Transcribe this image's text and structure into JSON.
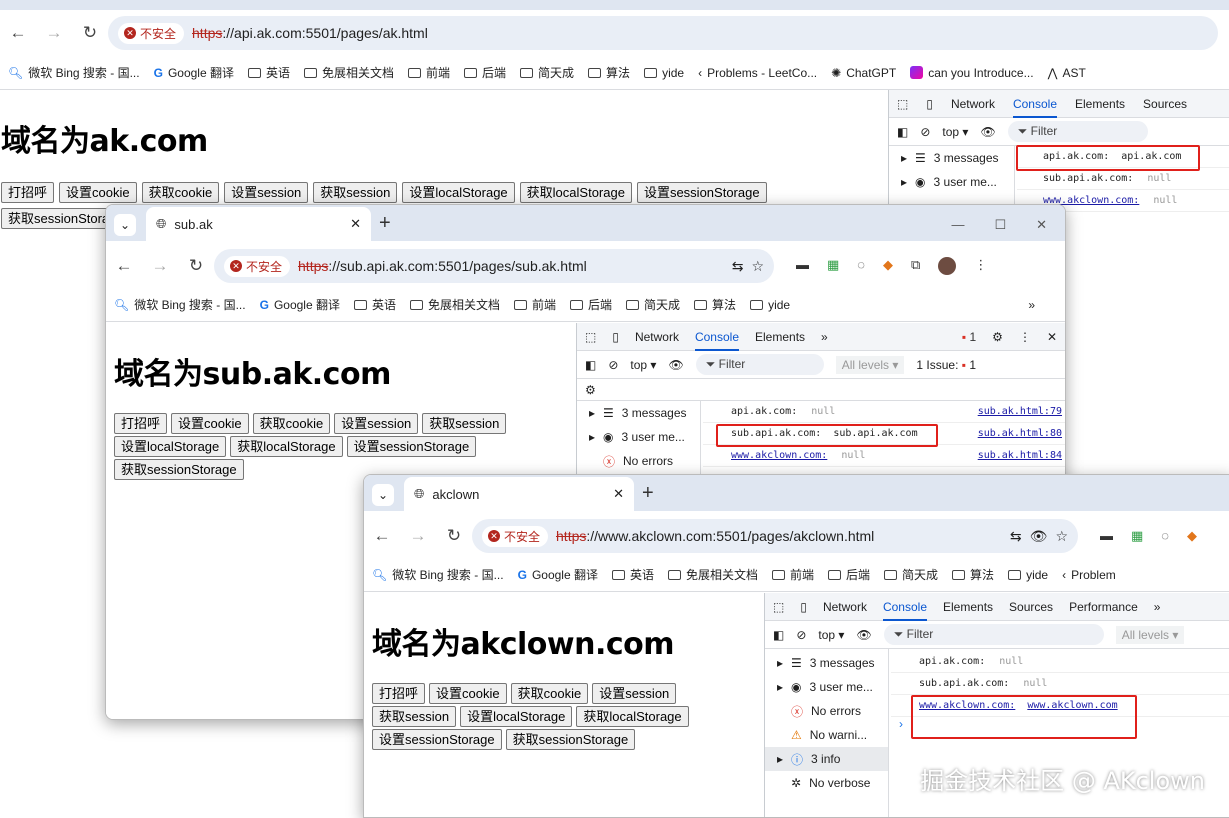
{
  "w1": {
    "url_scheme": "https",
    "url_rest": "://api.ak.com:5501/pages/ak.html",
    "insecure": "不安全",
    "bookmarks": [
      "微软 Bing 搜索 - 国...",
      "Google 翻译",
      "英语",
      "免展相关文档",
      "前端",
      "后端",
      "简天成",
      "算法",
      "yide",
      "Problems - LeetCo...",
      "ChatGPT",
      "can you Introduce...",
      "AST"
    ],
    "title": "域名为ak.com",
    "buttons": [
      "打招呼",
      "设置cookie",
      "获取cookie",
      "设置session",
      "获取session",
      "设置localStorage",
      "获取localStorage",
      "设置sessionStorage",
      "获取sessionStorage"
    ],
    "dt_tabs": [
      "Network",
      "Console",
      "Elements",
      "Sources"
    ],
    "top": "top",
    "filter": "Filter",
    "side": [
      "3 messages",
      "3 user me..."
    ],
    "logs": [
      {
        "k": "api.ak.com:",
        "v": "api.ak.com"
      },
      {
        "k": "sub.api.ak.com:",
        "v": "null"
      },
      {
        "k": "www.akclown.com:",
        "v": "null"
      }
    ]
  },
  "w2": {
    "tab_title": "sub.ak",
    "url_scheme": "https",
    "url_rest": "://sub.api.ak.com:5501/pages/sub.ak.html",
    "insecure": "不安全",
    "bookmarks": [
      "微软 Bing 搜索 - 国...",
      "Google 翻译",
      "英语",
      "免展相关文档",
      "前端",
      "后端",
      "简天成",
      "算法",
      "yide"
    ],
    "title": "域名为sub.ak.com",
    "buttons": [
      "打招呼",
      "设置cookie",
      "获取cookie",
      "设置session",
      "获取session",
      "设置localStorage",
      "获取localStorage",
      "设置sessionStorage",
      "获取sessionStorage"
    ],
    "dt_tabs": [
      "Network",
      "Console",
      "Elements"
    ],
    "errors": "1",
    "top": "top",
    "filter": "Filter",
    "levels": "All levels",
    "issue_label": "1 Issue:",
    "issue_count": "1",
    "side": [
      "3 messages",
      "3 user me...",
      "No errors"
    ],
    "logs": [
      {
        "k": "api.ak.com:",
        "v": "null",
        "src": "sub.ak.html:79"
      },
      {
        "k": "sub.api.ak.com:",
        "v": "sub.api.ak.com",
        "src": "sub.ak.html:80"
      },
      {
        "k": "www.akclown.com:",
        "v": "null",
        "src": "sub.ak.html:84"
      }
    ]
  },
  "w3": {
    "tab_title": "akclown",
    "url_scheme": "https",
    "url_rest": "://www.akclown.com:5501/pages/akclown.html",
    "insecure": "不安全",
    "bookmarks": [
      "微软 Bing 搜索 - 国...",
      "Google 翻译",
      "英语",
      "免展相关文档",
      "前端",
      "后端",
      "简天成",
      "算法",
      "yide",
      "Problem"
    ],
    "title": "域名为akclown.com",
    "buttons": [
      "打招呼",
      "设置cookie",
      "获取cookie",
      "设置session",
      "获取session",
      "设置localStorage",
      "获取localStorage",
      "设置sessionStorage",
      "获取sessionStorage"
    ],
    "dt_tabs": [
      "Network",
      "Console",
      "Elements",
      "Sources",
      "Performance"
    ],
    "top": "top",
    "filter": "Filter",
    "levels": "All levels",
    "side": [
      "3 messages",
      "3 user me...",
      "No errors",
      "No warni...",
      "3 info",
      "No verbose"
    ],
    "logs": [
      {
        "k": "api.ak.com:",
        "v": "null"
      },
      {
        "k": "sub.api.ak.com:",
        "v": "null"
      },
      {
        "k": "www.akclown.com:",
        "v": "www.akclown.com"
      }
    ]
  },
  "watermark": "掘金技术社区 @ AKclown"
}
